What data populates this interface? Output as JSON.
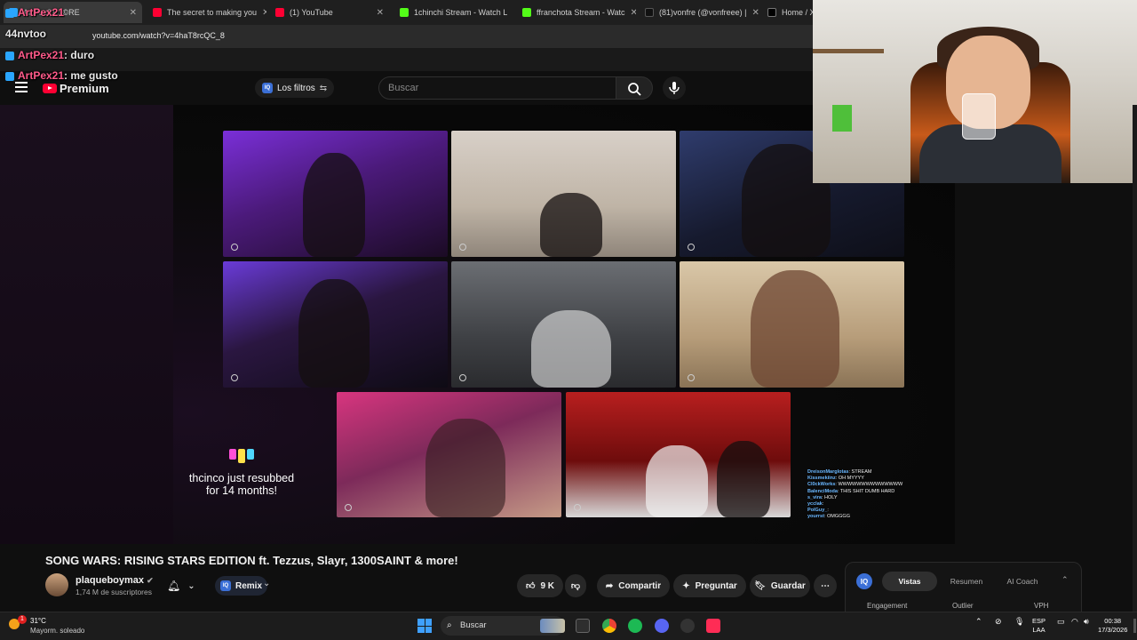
{
  "browser": {
    "tabs": [
      {
        "title": "ArtPex21 : ©RE",
        "active": true
      },
      {
        "title": "The secret to making you"
      },
      {
        "title": "(1) YouTube"
      },
      {
        "title": "1chinchi Stream - Watch L"
      },
      {
        "title": "ffranchota Stream - Watc"
      },
      {
        "title": "(81)vonfre (@vonfreee) |"
      },
      {
        "title": "Home / X"
      }
    ],
    "url": "youtube.com/watch?v=4haT8rcQC_8"
  },
  "chat_overlay": [
    {
      "user": "ArtPex21",
      "message": ""
    },
    {
      "user": "44nvtoo",
      "message": ""
    },
    {
      "user": "ArtPex21",
      "message": ": duro"
    },
    {
      "user": "ArtPex21",
      "message": ": me gusto"
    }
  ],
  "youtube": {
    "logo_text": "Premium",
    "filters_label": "Los filtros",
    "search_placeholder": "Buscar",
    "video_title": "SONG WARS: RISING STARS EDITION ft. Tezzus, Slayr, 1300SAINT & more!",
    "channel_name": "plaqueboymax",
    "subscribers": "1,74 M de suscriptores",
    "remix_label": "Remix",
    "likes": "9 K",
    "share_label": "Compartir",
    "ask_label": "Preguntar",
    "save_label": "Guardar",
    "panel": {
      "tabs": [
        "Vistas",
        "Resumen",
        "AI Coach"
      ],
      "labels": [
        "Engagement",
        "Outlier",
        "VPH"
      ]
    }
  },
  "player": {
    "resub_text": "thcinco just resubbed for 14 months!",
    "mini_chat": [
      {
        "name": "DreisonMarglotas",
        "msg": "STREAM"
      },
      {
        "name": "Kissmekiinz",
        "msg": "OH MYYYY"
      },
      {
        "name": "Cl0ckWorks",
        "msg": "WWWWWWWWWWWWWW"
      },
      {
        "name": "BalenciModa",
        "msg": "THIS SHIT DUMB HARD"
      },
      {
        "name": "s_vira",
        "msg": "HOLY"
      },
      {
        "name": "ycclak",
        "msg": ""
      },
      {
        "name": "PolGuy_",
        "msg": ""
      },
      {
        "name": "yourrst",
        "msg": "OMGGGG"
      }
    ]
  },
  "taskbar": {
    "temperature": "31°C",
    "weather": "Mayorm. soleado",
    "search_label": "Buscar",
    "lang": "ESP",
    "layout": "LAA",
    "time": "00:38",
    "date": "17/3/2026",
    "notif_count": "1"
  }
}
